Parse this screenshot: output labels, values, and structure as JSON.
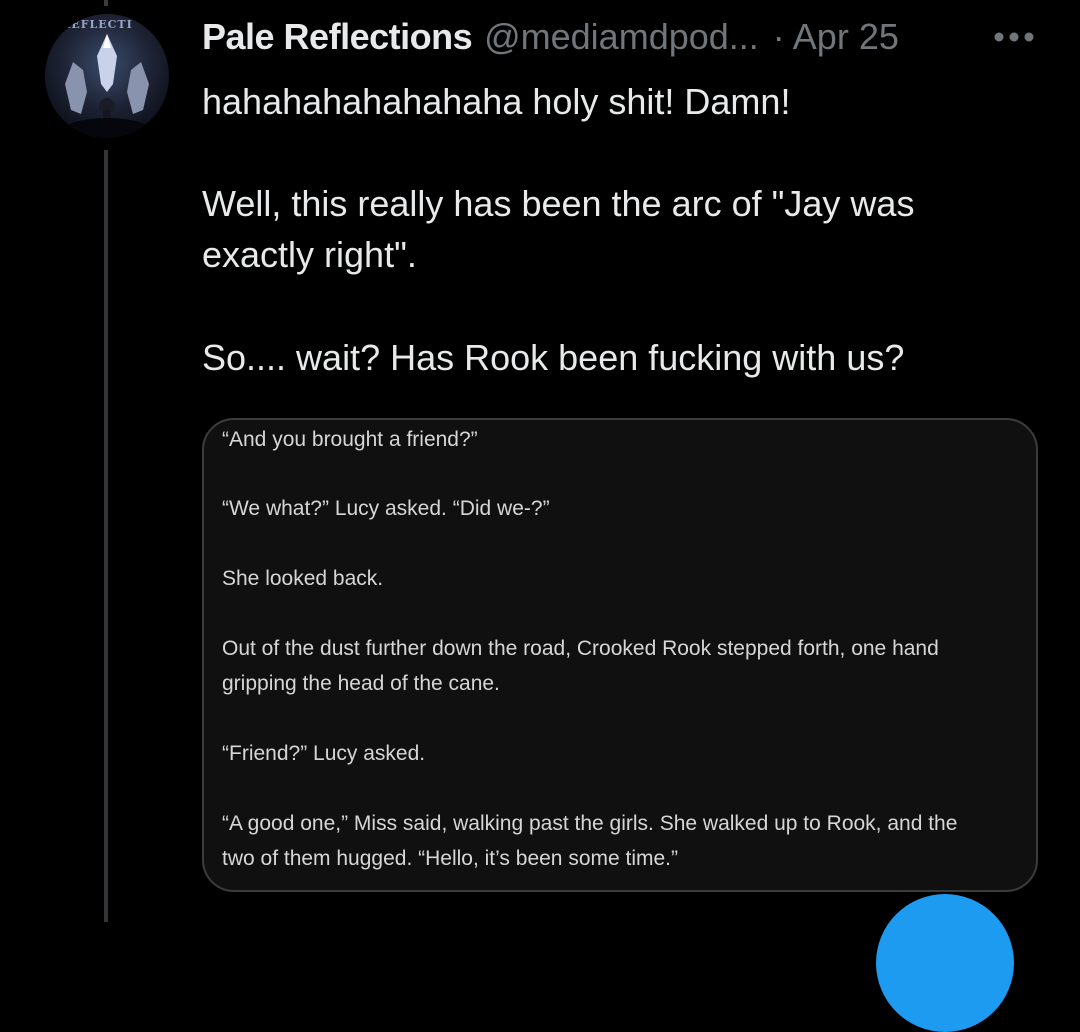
{
  "tweet": {
    "display_name": "Pale Reflections",
    "handle": "@mediamdpod...",
    "separator": "·",
    "date": "Apr 25",
    "more_label": "•••",
    "avatar_text": "E REFLECTI",
    "lines": [
      "hahahahahahahaha holy shit! Damn!",
      "Well, this really has been the arc of \"Jay was exactly right\".",
      "So.... wait? Has Rook been fucking with us?"
    ]
  },
  "media": {
    "excerpt_lines": [
      "“And you brought a friend?”",
      "“We what?” Lucy asked.  “Did we-?”",
      "She looked back.",
      "Out of the dust further down the road, Crooked Rook stepped forth, one hand",
      "gripping the head of the cane.",
      "“Friend?” Lucy asked.",
      "“A good one,” Miss said, walking past the girls.  She walked up to Rook, and the",
      "two of them hugged.  “Hello, it’s been some time.”"
    ]
  },
  "colors": {
    "background": "#000000",
    "primary_text": "#e7e9ea",
    "secondary_text": "#71767b",
    "card_border": "#3a3d40",
    "accent": "#1d9bf0"
  },
  "icons": {
    "more": "more-dots-icon",
    "compose": "compose-button"
  }
}
